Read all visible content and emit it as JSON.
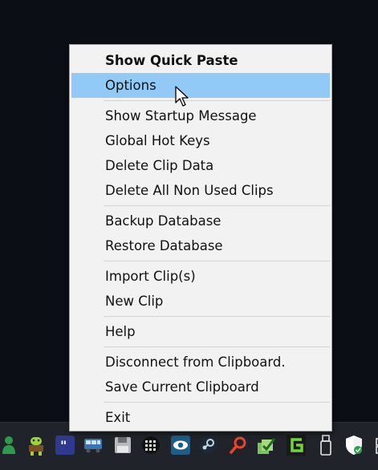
{
  "menu": {
    "groups": [
      [
        {
          "label": "Show Quick Paste",
          "bold": true
        },
        {
          "label": "Options",
          "highlighted": true
        }
      ],
      [
        {
          "label": "Show Startup Message"
        },
        {
          "label": "Global Hot Keys"
        },
        {
          "label": "Delete Clip Data"
        },
        {
          "label": "Delete All Non Used Clips"
        }
      ],
      [
        {
          "label": "Backup Database"
        },
        {
          "label": "Restore Database"
        }
      ],
      [
        {
          "label": "Import Clip(s)"
        },
        {
          "label": "New Clip"
        }
      ],
      [
        {
          "label": "Help"
        }
      ],
      [
        {
          "label": "Disconnect from Clipboard."
        },
        {
          "label": "Save Current Clipboard"
        }
      ],
      [
        {
          "label": "Exit"
        }
      ]
    ]
  },
  "colors": {
    "highlight": "#91c9f7",
    "menu_background": "#f2f2f2",
    "taskbar": "#20242a"
  },
  "tray_icons": [
    "person-green-icon",
    "android-green-icon",
    "quote-app-icon",
    "bus-icon",
    "save-disk-icon",
    "grid-keyboard-icon",
    "eye-icon",
    "steam-icon",
    "search-magnifier-icon",
    "checkbox-stack-icon",
    "green-g-icon",
    "usb-drive-icon",
    "shield-check-icon",
    "network-partial-icon"
  ]
}
